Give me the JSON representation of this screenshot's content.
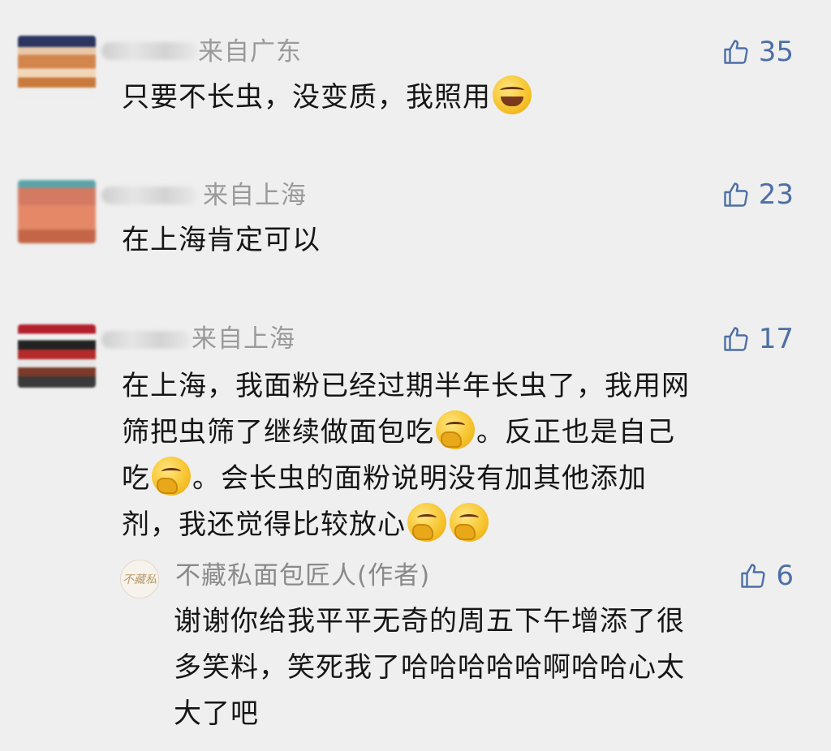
{
  "comments": [
    {
      "region": "来自广东",
      "likes": "35",
      "text": "只要不长虫，没变质，我照用"
    },
    {
      "region": "来自上海",
      "likes": "23",
      "text": "在上海肯定可以"
    },
    {
      "region": "来自上海",
      "likes": "17",
      "lines": [
        "在上海，我面粉已经过期半年长虫了，我用网",
        "筛把虫筛了继续做面包吃",
        "。反正也是自己",
        "吃",
        "。会长虫的面粉说明没有加其他添加",
        "剂，我还觉得比较放心"
      ]
    }
  ],
  "reply": {
    "avatar_text": "不藏私",
    "author": "不藏私面包匠人(作者)",
    "likes": "6",
    "lines": [
      "谢谢你给我平平无奇的周五下午增添了很",
      "多笑料，笑死我了哈哈哈哈哈啊哈哈心太",
      "大了吧"
    ]
  },
  "icons": {
    "like": "thumbs-up-icon",
    "emoji_laugh": "tears-of-joy-emoji",
    "emoji_think": "thinking-emoji"
  },
  "colors": {
    "background": "#efefef",
    "like_blue": "#4d6fa5",
    "meta_gray": "#9a9a9a"
  }
}
